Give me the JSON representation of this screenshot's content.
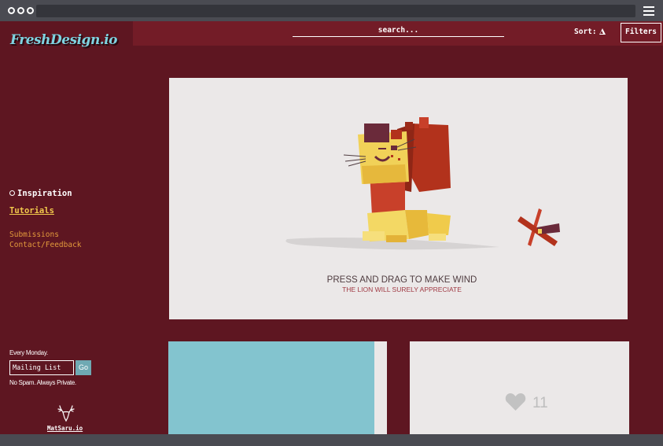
{
  "browser": {
    "window_dots": 3
  },
  "sidebar": {
    "logo": "FreshDesign.io",
    "nav": {
      "inspiration": "Inspiration",
      "tutorials": "Tutorials",
      "submissions": "Submissions",
      "contact": "Contact/Feedback"
    },
    "newsletter": {
      "every_monday": "Every Monday.",
      "input_value": "Mailing List",
      "go_label": "Go",
      "no_spam": "No Spam. Always Private."
    },
    "footer_link": "MatSaru.io",
    "footer_icon": "deer-icon"
  },
  "header": {
    "search_placeholder": "search...",
    "sort_label": "Sort:",
    "sort_icon": "triangle-up-icon",
    "filters_label": "Filters"
  },
  "main": {
    "feature": {
      "headline": "PRESS AND DRAG TO MAKE WIND",
      "subline": "THE LION WILL SURELY APPRECIATE"
    },
    "likes_card": {
      "icon": "heart-icon",
      "count": "11"
    }
  },
  "colors": {
    "background": "#5e1621",
    "header": "#731c27",
    "logo": "#7fd3e0",
    "tutorials": "#f2c94c",
    "secondary_nav": "#e29a3c",
    "card": "#ebe8e8",
    "teal_card": "#83c4cf"
  }
}
